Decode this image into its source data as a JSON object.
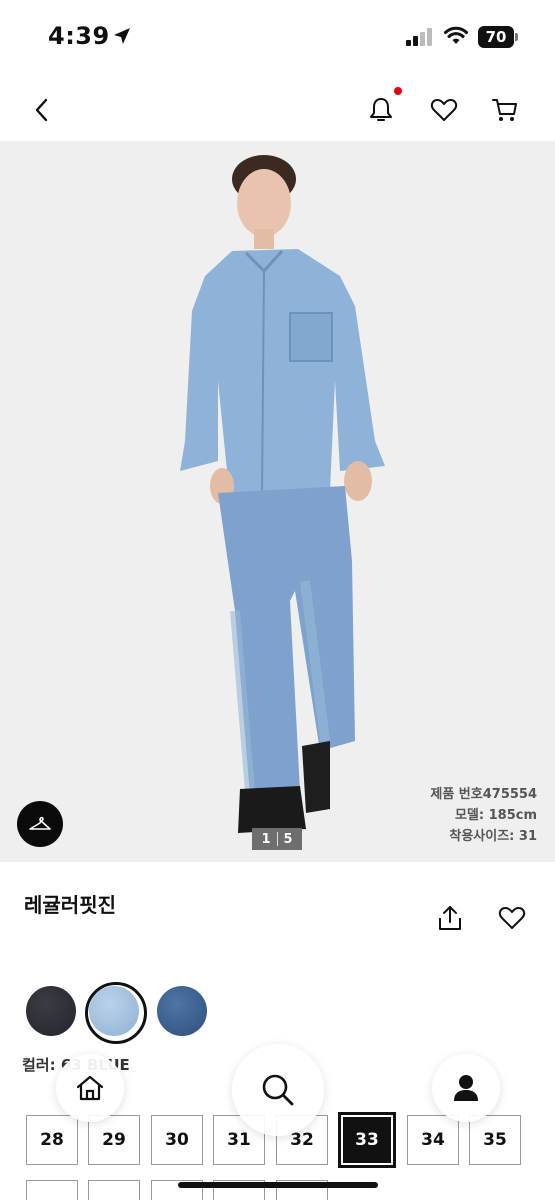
{
  "status_bar": {
    "time": "4:39",
    "battery_level": "70",
    "icons": [
      "location-arrow-icon",
      "signal-icon",
      "wifi-icon",
      "battery-icon"
    ]
  },
  "header": {
    "icons": [
      "chevron-left-icon",
      "bell-icon",
      "heart-icon",
      "cart-icon"
    ],
    "notification_dot_color": "#e60012"
  },
  "gallery": {
    "current_page": "1",
    "total_pages": "5",
    "product_number_line": "제품 번호475554",
    "model_line": "모델: 185cm",
    "size_worn_line": "착용사이즈: 31"
  },
  "product": {
    "name": "레귤러핏진",
    "color_label": "컬러: 63 BLUE",
    "swatches": [
      {
        "color": "#2c2f35"
      },
      {
        "color": "#a6c2e0",
        "selected": true
      },
      {
        "color": "#3c6190"
      }
    ]
  },
  "sizes": {
    "row1": [
      "28",
      "29",
      "30",
      "31",
      "32",
      "33",
      "34",
      "35"
    ],
    "selected": "33"
  },
  "bottom_nav": {
    "icons": [
      "home-icon",
      "search-icon",
      "user-icon"
    ]
  }
}
